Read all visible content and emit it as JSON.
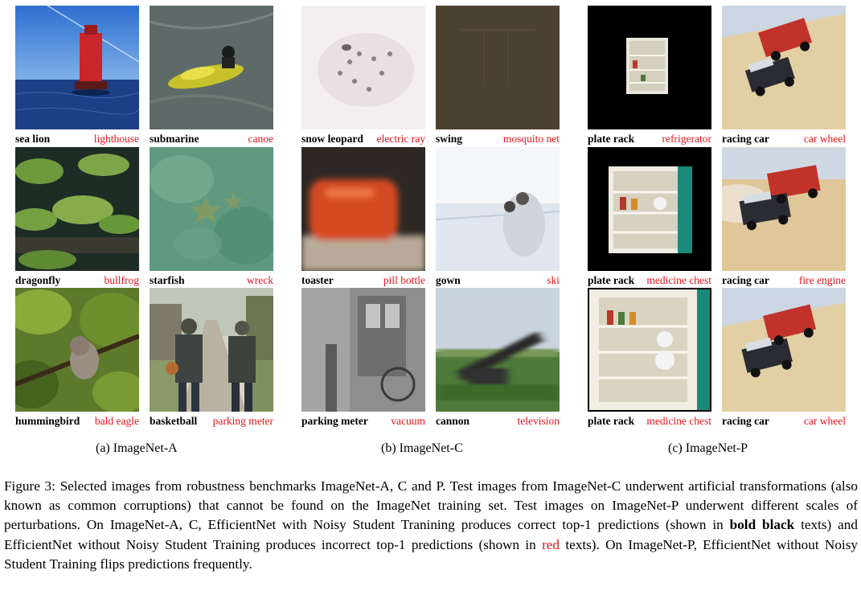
{
  "panels": [
    {
      "subcaption": "(a) ImageNet-A",
      "tiles": [
        {
          "correct": "sea lion",
          "wrong": "lighthouse"
        },
        {
          "correct": "submarine",
          "wrong": "canoe"
        },
        {
          "correct": "dragonfly",
          "wrong": "bullfrog"
        },
        {
          "correct": "starfish",
          "wrong": "wreck"
        },
        {
          "correct": "hummingbird",
          "wrong": "bald eagle"
        },
        {
          "correct": "basketball",
          "wrong": "parking meter"
        }
      ]
    },
    {
      "subcaption": "(b) ImageNet-C",
      "tiles": [
        {
          "correct": "snow leopard",
          "wrong": "electric ray"
        },
        {
          "correct": "swing",
          "wrong": "mosquito net"
        },
        {
          "correct": "toaster",
          "wrong": "pill bottle"
        },
        {
          "correct": "gown",
          "wrong": "ski"
        },
        {
          "correct": "parking meter",
          "wrong": "vacuum"
        },
        {
          "correct": "cannon",
          "wrong": "television"
        }
      ]
    },
    {
      "subcaption": "(c) ImageNet-P",
      "tiles": [
        {
          "correct": "plate rack",
          "wrong": "refrigerator"
        },
        {
          "correct": "racing car",
          "wrong": "car wheel"
        },
        {
          "correct": "plate rack",
          "wrong": "medicine chest"
        },
        {
          "correct": "racing car",
          "wrong": "fire engine"
        },
        {
          "correct": "plate rack",
          "wrong": "medicine chest"
        },
        {
          "correct": "racing car",
          "wrong": "car wheel"
        }
      ]
    }
  ],
  "caption": {
    "part1": "Figure 3: Selected images from robustness benchmarks ImageNet-A, C and P. Test images from ImageNet-C underwent artificial transformations (also known as common corruptions) that cannot be found on the ImageNet training set.  Test images on ImageNet-P underwent different scales of perturbations.  On ImageNet-A, C, EfficientNet with Noisy Student Tranining produces correct top-1 predictions (shown in ",
    "bold": "bold black",
    "part2": " texts) and EfficientNet without Noisy Student Training produces incorrect top-1 predictions (shown in ",
    "red": "red",
    "part3": " texts). On ImageNet-P, EfficientNet without Noisy Student Training flips predictions frequently."
  },
  "colors": {
    "wrong_label": "#e8141b",
    "correct_label": "#000000"
  }
}
